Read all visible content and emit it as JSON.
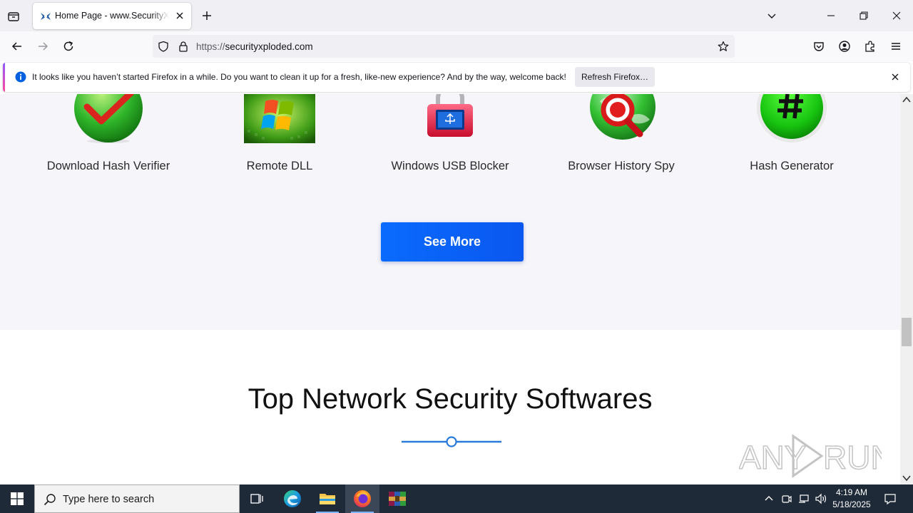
{
  "browser": {
    "tab": {
      "title": "Home Page - www.SecurityXploded.com"
    },
    "url": {
      "protocol": "https://",
      "host": "securityxploded.com"
    },
    "notification": {
      "message": "It looks like you haven’t started Firefox in a while. Do you want to clean it up for a fresh, like-new experience? And by the way, welcome back!",
      "button": "Refresh Firefox…"
    },
    "icons": [
      "tab-list-icon",
      "close-tab-icon",
      "new-tab-icon",
      "list-all-tabs-icon",
      "minimize-icon",
      "restore-icon",
      "close-window-icon",
      "back-icon",
      "forward-icon",
      "reload-icon",
      "shield-icon",
      "lock-icon",
      "star-icon",
      "pocket-icon",
      "account-icon",
      "extensions-icon",
      "menu-icon",
      "info-icon"
    ]
  },
  "page": {
    "products": [
      {
        "name": "Download Hash Verifier",
        "icon": "green-check-globe"
      },
      {
        "name": "Remote DLL",
        "icon": "windows-logo-tile"
      },
      {
        "name": "Windows USB Blocker",
        "icon": "red-padlock-usb"
      },
      {
        "name": "Browser History Spy",
        "icon": "red-magnifier-globe"
      },
      {
        "name": "Hash Generator",
        "icon": "green-hash-ball"
      }
    ],
    "see_more": "See More",
    "section_title": "Top Network Security Softwares",
    "watermark": "ANY RUN"
  },
  "taskbar": {
    "search_placeholder": "Type here to search",
    "time": "4:19 AM",
    "date": "5/18/2025",
    "apps": [
      "task-view-icon",
      "edge-icon",
      "file-explorer-icon",
      "firefox-icon",
      "winrar-icon"
    ]
  },
  "colors": {
    "accent": "#0a6bff",
    "taskbar": "#1f2a38"
  }
}
